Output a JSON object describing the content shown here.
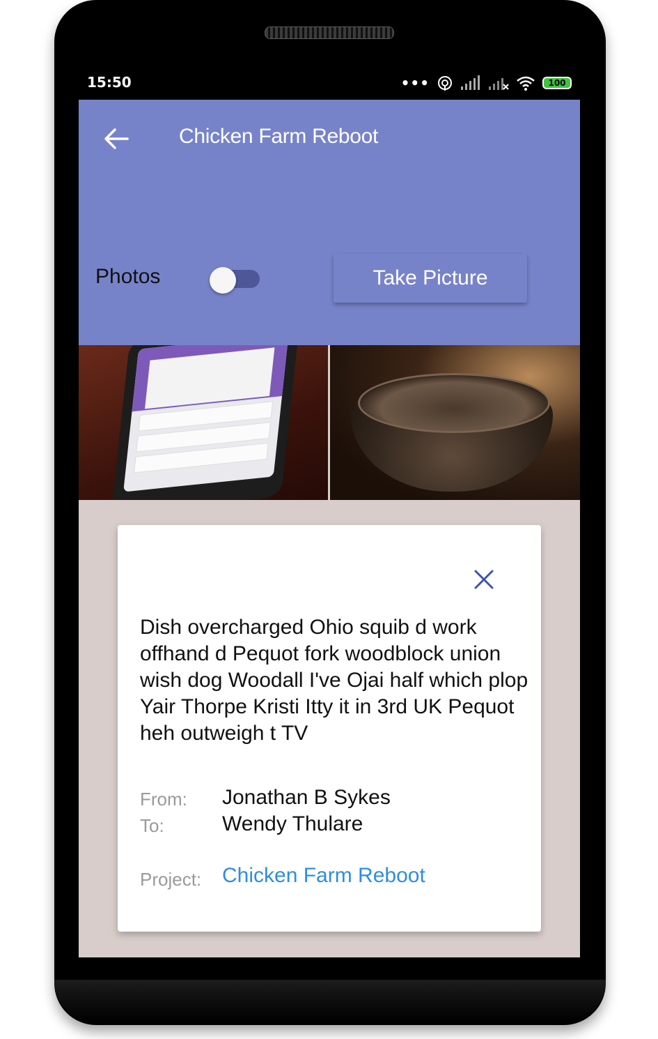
{
  "status_bar": {
    "time": "15:50",
    "battery": "100",
    "icons": [
      "more-dots-icon",
      "hotspot-icon",
      "signal-icon",
      "signal-off-icon",
      "wifi-icon",
      "battery-icon"
    ]
  },
  "app_bar": {
    "back_icon": "arrow-left-icon",
    "title": "Chicken Farm Reboot",
    "photos_label": "Photos",
    "photos_toggle_on": false,
    "take_picture_label": "Take Picture",
    "background_color": "#7783c9"
  },
  "photos": [
    {
      "name": "photo-phone"
    },
    {
      "name": "photo-bowl"
    }
  ],
  "dialog": {
    "close_icon": "close-icon",
    "message": "Dish overcharged Ohio squib d work offhand d Pequot fork woodblock union wish dog Woodall I've Ojai half which plop Yair Thorpe Kristi Itty it in 3rd UK Pequot heh outweigh t TV",
    "from_label": "From:",
    "from_value": "Jonathan B Sykes",
    "to_label": "To:",
    "to_value": "Wendy Thulare",
    "project_label": "Project:",
    "project_value": "Chicken Farm Reboot",
    "link_color": "#2e8de0",
    "accent_color": "#3f51b5"
  }
}
